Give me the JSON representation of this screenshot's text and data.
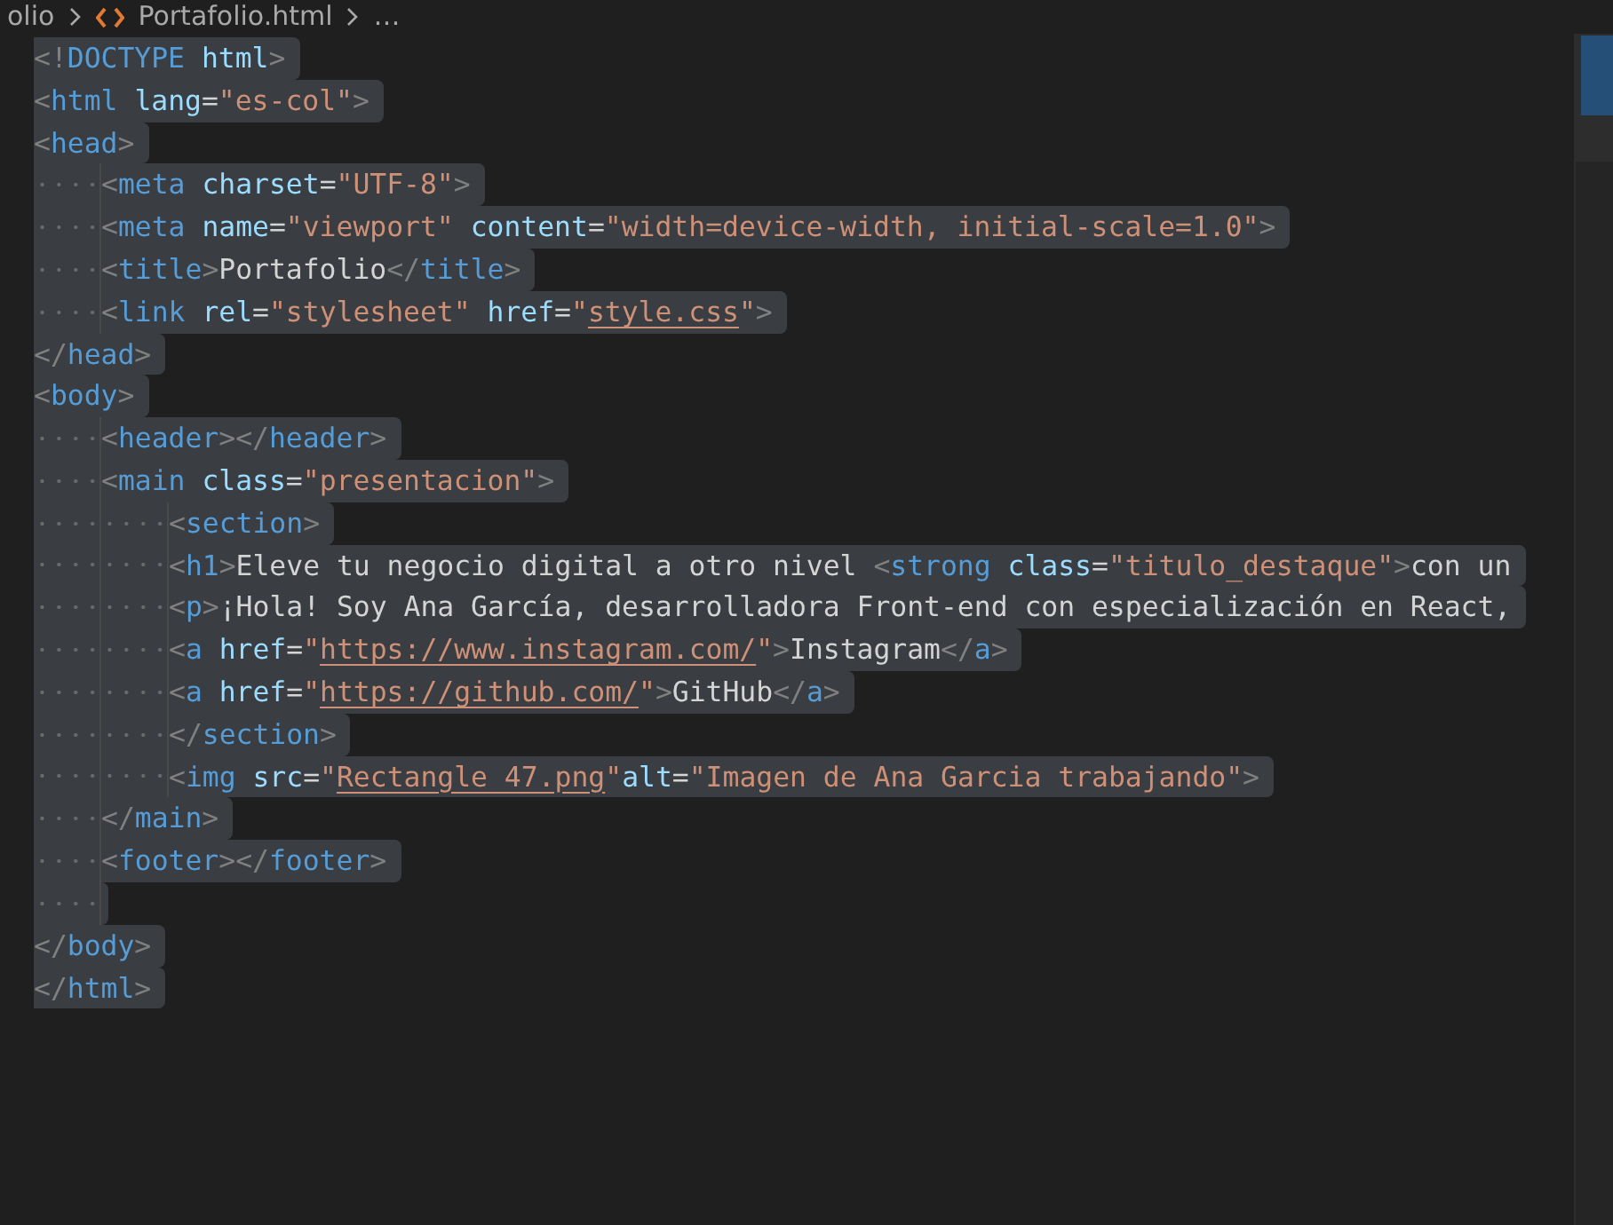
{
  "breadcrumb": [
    {
      "kind": "folder",
      "text": "olio"
    },
    {
      "kind": "file",
      "text": "Portafolio.html"
    },
    {
      "kind": "more",
      "text": "…"
    }
  ],
  "lines": [
    {
      "tokens": [
        {
          "kind": "punct",
          "text": "<!"
        },
        {
          "kind": "tag",
          "text": "DOCTYPE "
        },
        {
          "kind": "attr",
          "text": "html"
        },
        {
          "kind": "punct",
          "text": ">"
        }
      ]
    },
    {
      "tokens": [
        {
          "kind": "punct",
          "text": "<"
        },
        {
          "kind": "tag",
          "text": "html "
        },
        {
          "kind": "attr",
          "text": "lang"
        },
        {
          "kind": "text",
          "text": "="
        },
        {
          "kind": "string",
          "text": "\"es-col\""
        },
        {
          "kind": "punct",
          "text": ">"
        }
      ]
    },
    {
      "tokens": [
        {
          "kind": "punct",
          "text": "<"
        },
        {
          "kind": "tag",
          "text": "head"
        },
        {
          "kind": "punct",
          "text": ">"
        }
      ],
      "children": [
        {
          "tokens": [
            {
              "kind": "punct",
              "text": "<"
            },
            {
              "kind": "tag",
              "text": "meta "
            },
            {
              "kind": "attr",
              "text": "charset"
            },
            {
              "kind": "text",
              "text": "="
            },
            {
              "kind": "string",
              "text": "\"UTF-8\""
            },
            {
              "kind": "punct",
              "text": ">"
            }
          ]
        },
        {
          "tokens": [
            {
              "kind": "punct",
              "text": "<"
            },
            {
              "kind": "tag",
              "text": "meta "
            },
            {
              "kind": "attr",
              "text": "name"
            },
            {
              "kind": "text",
              "text": "="
            },
            {
              "kind": "string",
              "text": "\"viewport\" "
            },
            {
              "kind": "attr",
              "text": "content"
            },
            {
              "kind": "text",
              "text": "="
            },
            {
              "kind": "string",
              "text": "\"width=device-width, initial-scale=1.0\""
            },
            {
              "kind": "punct",
              "text": ">"
            }
          ]
        },
        {
          "tokens": [
            {
              "kind": "punct",
              "text": "<"
            },
            {
              "kind": "tag",
              "text": "title"
            },
            {
              "kind": "punct",
              "text": ">"
            },
            {
              "kind": "text",
              "text": "Portafolio"
            },
            {
              "kind": "punct",
              "text": "</"
            },
            {
              "kind": "tag",
              "text": "title"
            },
            {
              "kind": "punct",
              "text": ">"
            }
          ]
        },
        {
          "tokens": [
            {
              "kind": "punct",
              "text": "<"
            },
            {
              "kind": "tag",
              "text": "link "
            },
            {
              "kind": "attr",
              "text": "rel"
            },
            {
              "kind": "text",
              "text": "="
            },
            {
              "kind": "string",
              "text": "\"stylesheet\" "
            },
            {
              "kind": "attr",
              "text": "href"
            },
            {
              "kind": "text",
              "text": "="
            },
            {
              "kind": "string",
              "text": "\""
            },
            {
              "kind": "link",
              "text": "style.css"
            },
            {
              "kind": "string",
              "text": "\""
            },
            {
              "kind": "punct",
              "text": ">"
            }
          ]
        }
      ]
    },
    {
      "tokens": [
        {
          "kind": "punct",
          "text": "</"
        },
        {
          "kind": "tag",
          "text": "head"
        },
        {
          "kind": "punct",
          "text": ">"
        }
      ]
    },
    {
      "tokens": [
        {
          "kind": "punct",
          "text": "<"
        },
        {
          "kind": "tag",
          "text": "body"
        },
        {
          "kind": "punct",
          "text": ">"
        }
      ],
      "children": [
        {
          "tokens": [
            {
              "kind": "punct",
              "text": "<"
            },
            {
              "kind": "tag",
              "text": "header"
            },
            {
              "kind": "punct",
              "text": "></"
            },
            {
              "kind": "tag",
              "text": "header"
            },
            {
              "kind": "punct",
              "text": ">"
            }
          ]
        },
        {
          "tokens": [
            {
              "kind": "punct",
              "text": "<"
            },
            {
              "kind": "tag",
              "text": "main "
            },
            {
              "kind": "attr",
              "text": "class"
            },
            {
              "kind": "text",
              "text": "="
            },
            {
              "kind": "string",
              "text": "\"presentacion\""
            },
            {
              "kind": "punct",
              "text": ">"
            }
          ],
          "children": [
            {
              "tokens": [
                {
                  "kind": "punct",
                  "text": "<"
                },
                {
                  "kind": "tag",
                  "text": "section"
                },
                {
                  "kind": "punct",
                  "text": ">"
                }
              ]
            },
            {
              "tokens": [
                {
                  "kind": "punct",
                  "text": "<"
                },
                {
                  "kind": "tag",
                  "text": "h1"
                },
                {
                  "kind": "punct",
                  "text": ">"
                },
                {
                  "kind": "text",
                  "text": "Eleve tu negocio digital a otro nivel "
                },
                {
                  "kind": "punct",
                  "text": "<"
                },
                {
                  "kind": "tag",
                  "text": "strong "
                },
                {
                  "kind": "attr",
                  "text": "class"
                },
                {
                  "kind": "text",
                  "text": "="
                },
                {
                  "kind": "string",
                  "text": "\"titulo_destaque\""
                },
                {
                  "kind": "punct",
                  "text": ">"
                },
                {
                  "kind": "text",
                  "text": "con un"
                }
              ]
            },
            {
              "tokens": [
                {
                  "kind": "punct",
                  "text": "<"
                },
                {
                  "kind": "tag",
                  "text": "p"
                },
                {
                  "kind": "punct",
                  "text": ">"
                },
                {
                  "kind": "text",
                  "text": "¡Hola! Soy Ana García, desarrolladora Front-end con especialización en React,"
                }
              ]
            },
            {
              "tokens": [
                {
                  "kind": "punct",
                  "text": "<"
                },
                {
                  "kind": "tag",
                  "text": "a "
                },
                {
                  "kind": "attr",
                  "text": "href"
                },
                {
                  "kind": "text",
                  "text": "="
                },
                {
                  "kind": "string",
                  "text": "\""
                },
                {
                  "kind": "link",
                  "text": "https://www.instagram.com/"
                },
                {
                  "kind": "string",
                  "text": "\""
                },
                {
                  "kind": "punct",
                  "text": ">"
                },
                {
                  "kind": "text",
                  "text": "Instagram"
                },
                {
                  "kind": "punct",
                  "text": "</"
                },
                {
                  "kind": "tag",
                  "text": "a"
                },
                {
                  "kind": "punct",
                  "text": ">"
                }
              ]
            },
            {
              "tokens": [
                {
                  "kind": "punct",
                  "text": "<"
                },
                {
                  "kind": "tag",
                  "text": "a "
                },
                {
                  "kind": "attr",
                  "text": "href"
                },
                {
                  "kind": "text",
                  "text": "="
                },
                {
                  "kind": "string",
                  "text": "\""
                },
                {
                  "kind": "link",
                  "text": "https://github.com/"
                },
                {
                  "kind": "string",
                  "text": "\""
                },
                {
                  "kind": "punct",
                  "text": ">"
                },
                {
                  "kind": "text",
                  "text": "GitHub"
                },
                {
                  "kind": "punct",
                  "text": "</"
                },
                {
                  "kind": "tag",
                  "text": "a"
                },
                {
                  "kind": "punct",
                  "text": ">"
                }
              ]
            },
            {
              "tokens": [
                {
                  "kind": "punct",
                  "text": "</"
                },
                {
                  "kind": "tag",
                  "text": "section"
                },
                {
                  "kind": "punct",
                  "text": ">"
                }
              ]
            },
            {
              "tokens": [
                {
                  "kind": "punct",
                  "text": "<"
                },
                {
                  "kind": "tag",
                  "text": "img "
                },
                {
                  "kind": "attr",
                  "text": "src"
                },
                {
                  "kind": "text",
                  "text": "="
                },
                {
                  "kind": "string",
                  "text": "\""
                },
                {
                  "kind": "link",
                  "text": "Rectangle 47.png"
                },
                {
                  "kind": "string",
                  "text": "\""
                },
                {
                  "kind": "attr",
                  "text": "alt"
                },
                {
                  "kind": "text",
                  "text": "="
                },
                {
                  "kind": "string",
                  "text": "\"Imagen de Ana Garcia trabajando\""
                },
                {
                  "kind": "punct",
                  "text": ">"
                }
              ]
            }
          ]
        },
        {
          "tokens": [
            {
              "kind": "punct",
              "text": "</"
            },
            {
              "kind": "tag",
              "text": "main"
            },
            {
              "kind": "punct",
              "text": ">"
            }
          ]
        },
        {
          "tokens": [
            {
              "kind": "punct",
              "text": "<"
            },
            {
              "kind": "tag",
              "text": "footer"
            },
            {
              "kind": "punct",
              "text": "></"
            },
            {
              "kind": "tag",
              "text": "footer"
            },
            {
              "kind": "punct",
              "text": ">"
            }
          ]
        },
        {
          "kind": "blank"
        }
      ]
    },
    {
      "tokens": [
        {
          "kind": "punct",
          "text": "</"
        },
        {
          "kind": "tag",
          "text": "body"
        },
        {
          "kind": "punct",
          "text": ">"
        }
      ]
    },
    {
      "tokens": [
        {
          "kind": "punct",
          "text": "</"
        },
        {
          "kind": "tag",
          "text": "html"
        },
        {
          "kind": "punct",
          "text": ">"
        }
      ]
    }
  ]
}
